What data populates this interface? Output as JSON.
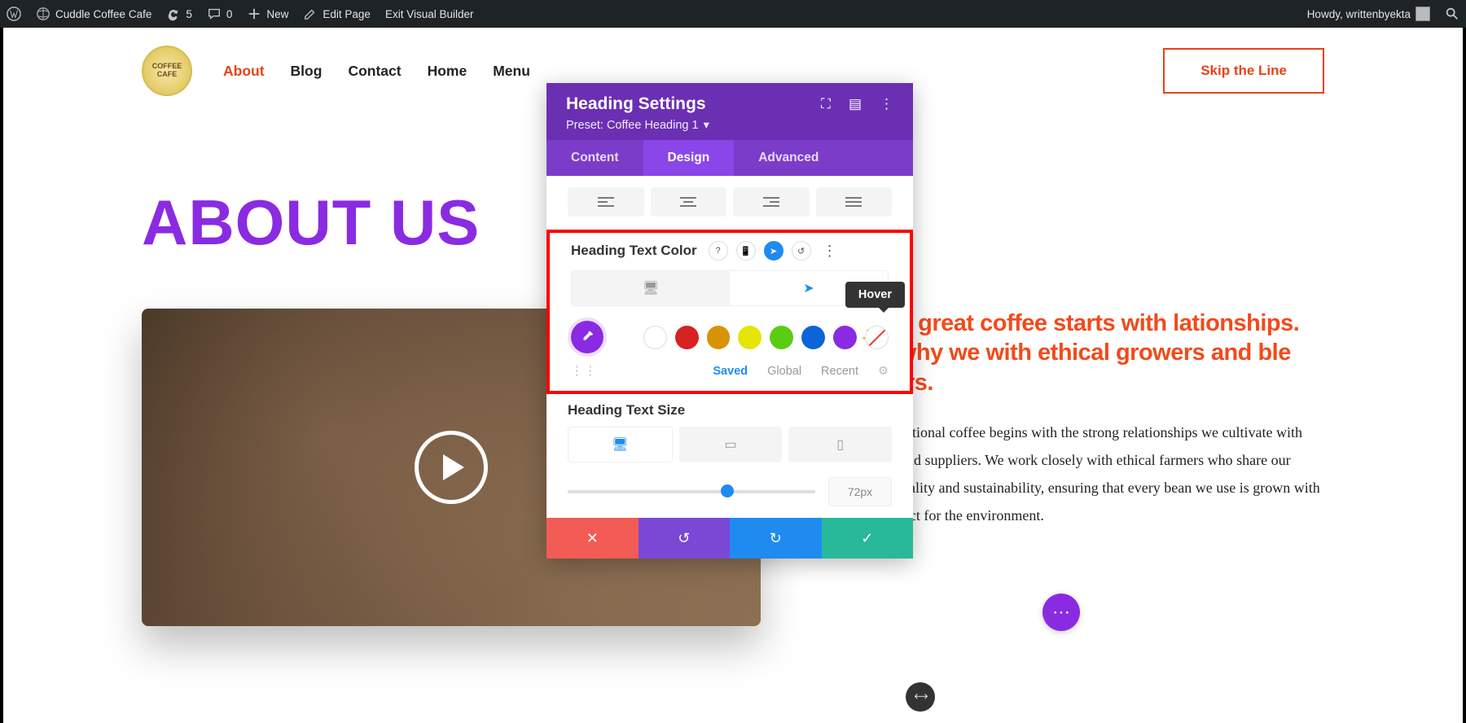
{
  "adminbar": {
    "site": "Cuddle Coffee Cafe",
    "updates": "5",
    "comments": "0",
    "new": "New",
    "edit": "Edit Page",
    "exit": "Exit Visual Builder",
    "howdy": "Howdy, writtenbyekta"
  },
  "logo_text": "COFFEE\nCAFE",
  "nav": {
    "about": "About",
    "blog": "Blog",
    "contact": "Contact",
    "home": "Home",
    "menu": "Menu"
  },
  "cta": "Skip the Line",
  "heading": "ABOUT US",
  "lead": "eve that great coffee starts with lationships. That's why we with ethical growers and ble suppliers.",
  "body": "tment to exceptional coffee begins with the strong relationships we cultivate with our growers and suppliers. We work closely with ethical farmers who share our passion for quality and sustainability, ensuring that every bean we use is grown with care and respect for the environment.",
  "panel": {
    "title": "Heading Settings",
    "preset": "Preset: Coffee Heading 1",
    "tabs": {
      "content": "Content",
      "design": "Design",
      "advanced": "Advanced"
    },
    "color_label": "Heading Text Color",
    "tooltip": "Hover",
    "palette_footer": {
      "saved": "Saved",
      "global": "Global",
      "recent": "Recent"
    },
    "size_label": "Heading Text Size",
    "size_value": "72px",
    "swatches": {
      "black": "#000000",
      "white": "#ffffff",
      "red": "#d62222",
      "amber": "#d99307",
      "yellow": "#e5e505",
      "green": "#5bcc14",
      "blue": "#0b64d8",
      "purple": "#8a2be2"
    }
  }
}
